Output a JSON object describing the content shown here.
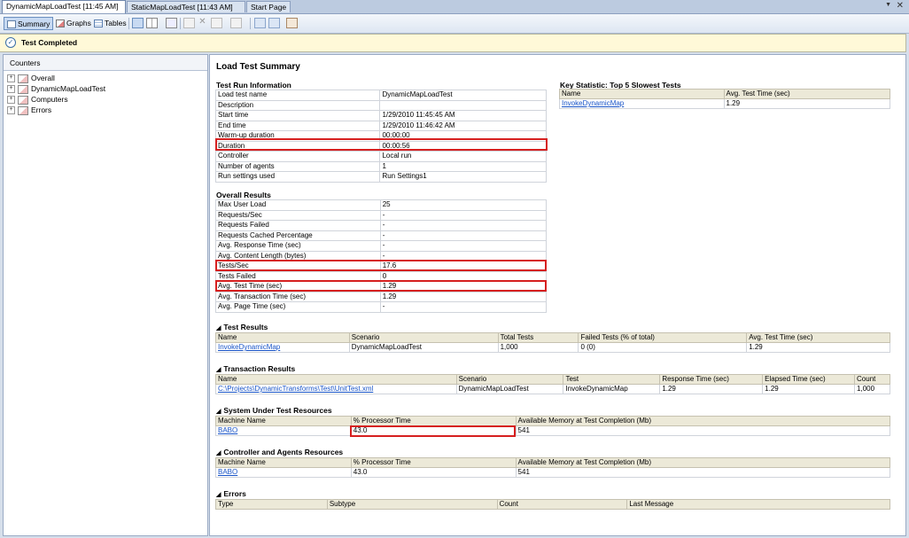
{
  "tabs": [
    {
      "label": "DynamicMapLoadTest [11:45 AM]",
      "active": true
    },
    {
      "label": "StaticMapLoadTest [11:43 AM]",
      "active": false
    },
    {
      "label": "Start Page",
      "active": false
    }
  ],
  "window": {
    "close_glyph": "✕",
    "dropdown_glyph": "▼"
  },
  "toolbar": {
    "summary_label": "Summary",
    "graphs_label": "Graphs",
    "tables_label": "Tables"
  },
  "notice": {
    "text": "Test Completed",
    "icon": "check-circle-icon"
  },
  "counters": {
    "header": "Counters",
    "items": [
      "Overall",
      "DynamicMapLoadTest",
      "Computers",
      "Errors"
    ]
  },
  "summary": {
    "title": "Load Test Summary",
    "run_info": {
      "title": "Test Run Information",
      "rows": [
        {
          "label": "Load test name",
          "value": "DynamicMapLoadTest"
        },
        {
          "label": "Description",
          "value": ""
        },
        {
          "label": "Start time",
          "value": "1/29/2010 11:45:45 AM"
        },
        {
          "label": "End time",
          "value": "1/29/2010 11:46:42 AM"
        },
        {
          "label": "Warm-up duration",
          "value": "00:00:00"
        },
        {
          "label": "Duration",
          "value": "00:00:56"
        },
        {
          "label": "Controller",
          "value": "Local run"
        },
        {
          "label": "Number of agents",
          "value": "1"
        },
        {
          "label": "Run settings used",
          "value": "Run Settings1"
        }
      ]
    },
    "key_stat": {
      "title": "Key Statistic: Top 5 Slowest Tests",
      "headers": [
        "Name",
        "Avg. Test Time (sec)"
      ],
      "rows": [
        [
          "InvokeDynamicMap",
          "1.29"
        ]
      ]
    },
    "overall": {
      "title": "Overall Results",
      "rows": [
        {
          "label": "Max User Load",
          "value": "25"
        },
        {
          "label": "Requests/Sec",
          "value": "-"
        },
        {
          "label": "Requests Failed",
          "value": "-"
        },
        {
          "label": "Requests Cached Percentage",
          "value": "-"
        },
        {
          "label": "Avg. Response Time (sec)",
          "value": "-"
        },
        {
          "label": "Avg. Content Length (bytes)",
          "value": "-"
        },
        {
          "label": "Tests/Sec",
          "value": "17.6"
        },
        {
          "label": "Tests Failed",
          "value": "0"
        },
        {
          "label": "Avg. Test Time (sec)",
          "value": "1.29"
        },
        {
          "label": "Avg. Transaction Time (sec)",
          "value": "1.29"
        },
        {
          "label": "Avg. Page Time (sec)",
          "value": "-"
        }
      ]
    },
    "test_results": {
      "title": "Test Results",
      "headers": [
        "Name",
        "Scenario",
        "Total Tests",
        "Failed Tests (% of total)",
        "Avg. Test Time (sec)"
      ],
      "rows": [
        [
          "InvokeDynamicMap",
          "DynamicMapLoadTest",
          "1,000",
          "0 (0)",
          "1.29"
        ]
      ]
    },
    "transaction_results": {
      "title": "Transaction Results",
      "headers": [
        "Name",
        "Scenario",
        "Test",
        "Response Time (sec)",
        "Elapsed Time (sec)",
        "Count"
      ],
      "rows": [
        [
          "C:\\Projects\\DynamicTransforms\\Test\\UnitTest.xml",
          "DynamicMapLoadTest",
          "InvokeDynamicMap",
          "1.29",
          "1.29",
          "1,000"
        ]
      ]
    },
    "sut_resources": {
      "title": "System Under Test Resources",
      "headers": [
        "Machine Name",
        "% Processor Time",
        "Available Memory at Test Completion (Mb)"
      ],
      "rows": [
        [
          "BABO",
          "43.0",
          "541"
        ]
      ]
    },
    "agent_resources": {
      "title": "Controller and Agents Resources",
      "headers": [
        "Machine Name",
        "% Processor Time",
        "Available Memory at Test Completion (Mb)"
      ],
      "rows": [
        [
          "BABO",
          "43.0",
          "541"
        ]
      ]
    },
    "errors": {
      "title": "Errors",
      "headers": [
        "Type",
        "Subtype",
        "Count",
        "Last Message"
      ]
    }
  }
}
